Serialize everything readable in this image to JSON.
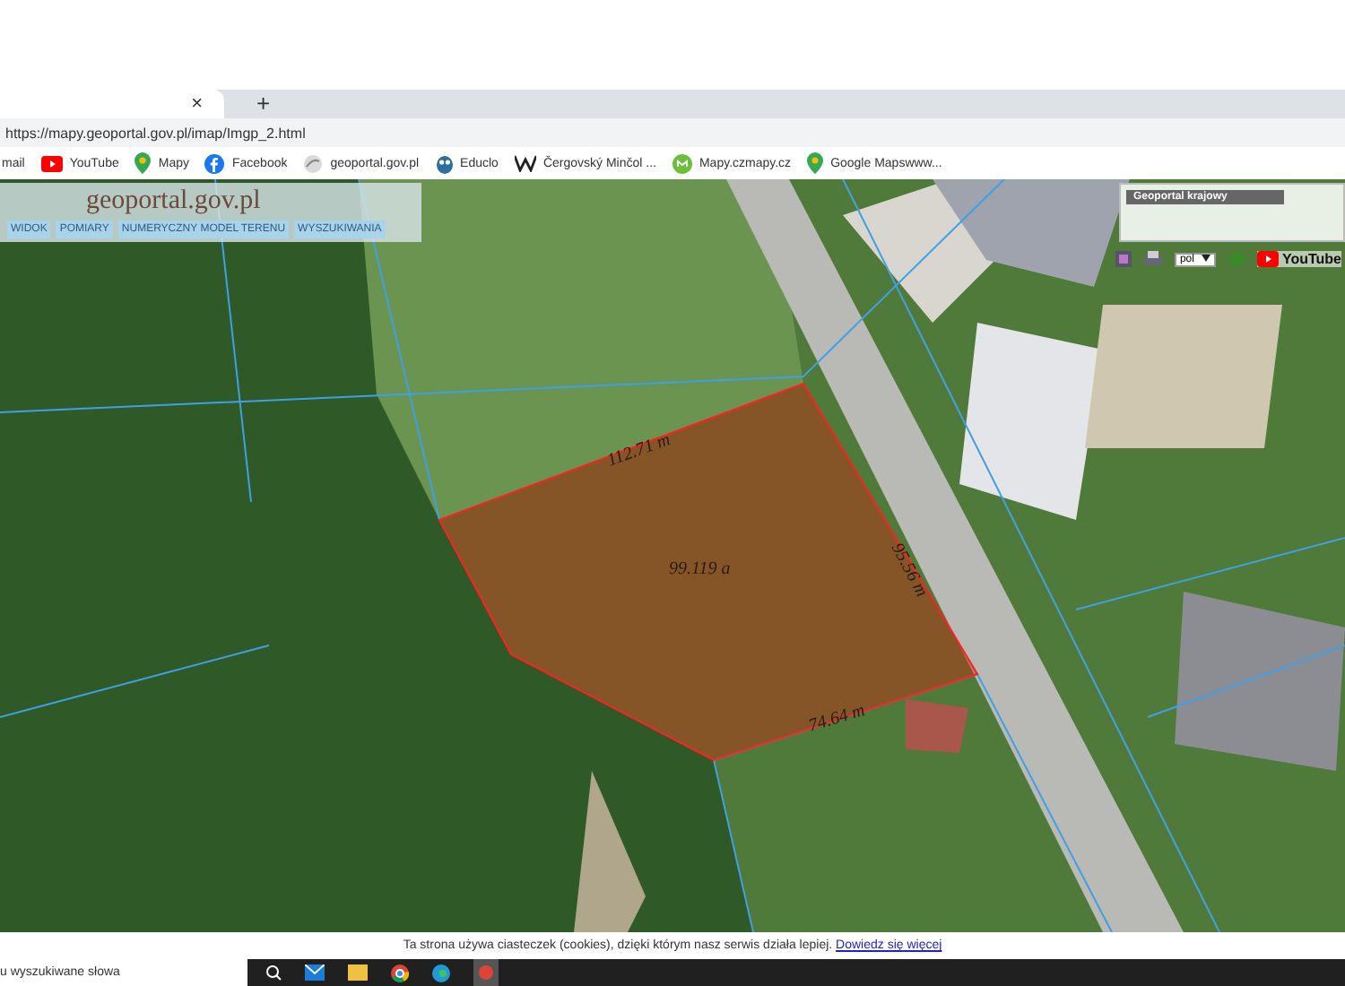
{
  "browser": {
    "tab_close": "×",
    "new_tab": "+",
    "url": "https://mapy.geoportal.gov.pl/imap/Imgp_2.html",
    "bookmarks": [
      {
        "label": "mail",
        "kind": "plain"
      },
      {
        "label": "YouTube",
        "kind": "youtube"
      },
      {
        "label": "Mapy",
        "kind": "pin"
      },
      {
        "label": "Facebook",
        "kind": "facebook"
      },
      {
        "label": "geoportal.gov.pl",
        "kind": "geoportal"
      },
      {
        "label": "Educlo",
        "kind": "educlo"
      },
      {
        "label": "Čergovský Minčol ...",
        "kind": "wiki"
      },
      {
        "label": "Mapy.czmapy.cz",
        "kind": "mapycz"
      },
      {
        "label": "Google Mapswww...",
        "kind": "pin"
      }
    ]
  },
  "map": {
    "logo": "geoportal.gov.pl",
    "menu": [
      "WIDOK",
      "POMIARY",
      "NUMERYCZNY MODEL TERENU",
      "WYSZUKIWANIA"
    ],
    "overview_title": "Geoportal krajowy",
    "language": "pol",
    "youtube": "YouTube",
    "parcel": {
      "area": "99.119 a",
      "edges": [
        "112.71 m",
        "95.56 m",
        "74.64 m"
      ]
    }
  },
  "cookie_bar": {
    "text": "Ta strona używa ciasteczek (cookies), dzięki którym nasz serwis działa lepiej.",
    "link": "Dowiedz się więcej"
  },
  "taskbar": {
    "search_placeholder": "u wyszukiwane słowa"
  }
}
